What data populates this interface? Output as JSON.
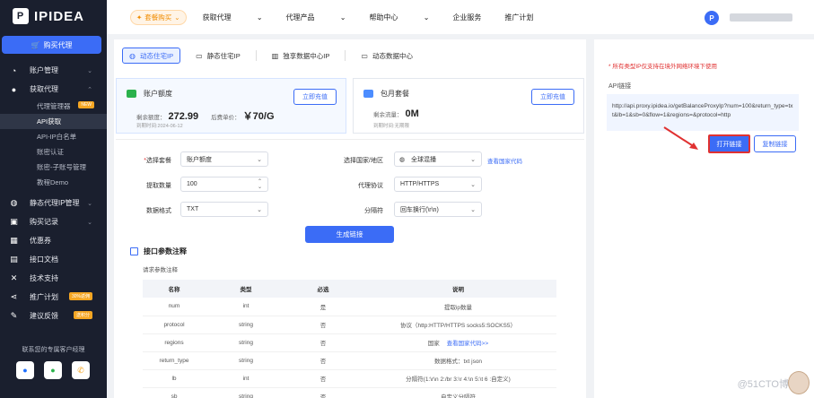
{
  "brand": {
    "name": "IPIDEA",
    "mark": "P"
  },
  "sidebar": {
    "buy_button": "购买代理",
    "groups": [
      {
        "label": "账户管理",
        "icon": "pie-chart-icon"
      },
      {
        "label": "获取代理",
        "icon": "user-icon"
      }
    ],
    "sub_items": [
      {
        "label": "代理管理器",
        "badge": "NEW"
      },
      {
        "label": "API获取"
      },
      {
        "label": "API-IP白名单"
      },
      {
        "label": "账密认证"
      },
      {
        "label": "账密-子账号管理"
      },
      {
        "label": "教程Demo"
      }
    ],
    "lower_groups": [
      {
        "label": "静态代理IP管理",
        "icon": "globe-icon"
      },
      {
        "label": "购买记录",
        "icon": "gift-icon"
      },
      {
        "label": "优惠券",
        "icon": "grid-icon"
      },
      {
        "label": "接口文档",
        "icon": "doc-icon"
      },
      {
        "label": "技术支持",
        "icon": "tools-icon"
      },
      {
        "label": "推广计划",
        "icon": "share-icon",
        "badge": "30%返佣"
      },
      {
        "label": "建议反馈",
        "icon": "feedback-icon",
        "badge": "送积分"
      }
    ],
    "contact": "联系您的专属客户经理"
  },
  "topbar": {
    "promo": "套餐购买",
    "nav": [
      "获取代理",
      "代理产品",
      "帮助中心",
      "企业服务",
      "推广计划"
    ]
  },
  "tabs": [
    "动态住宅IP",
    "静态住宅IP",
    "独享数据中心IP",
    "动态数据中心"
  ],
  "cards": {
    "balance": {
      "title": "账户额度",
      "remain_label": "剩余额度：",
      "remain_value": "272.99",
      "price_label": "后费单价：",
      "price_value": "￥70/G",
      "expire": "到期时间:2024-06-12",
      "button": "立即充值"
    },
    "monthly": {
      "title": "包月套餐",
      "remain_label": "剩余流量：",
      "remain_value": "0M",
      "expire": "到期时间:无期限",
      "button": "立即充值"
    }
  },
  "form": {
    "package_label": "选择套餐",
    "package_value": "账户额度",
    "country_label": "选择国家/地区",
    "country_value": "全球混播",
    "country_link": "查看国家代码",
    "count_label": "提取数量",
    "count_value": "100",
    "protocol_label": "代理协议",
    "protocol_value": "HTTP/HTTPS",
    "format_label": "数据格式",
    "format_value": "TXT",
    "sep_label": "分隔符",
    "sep_value": "回车换行(\\r\\n)",
    "generate": "生成链接"
  },
  "params": {
    "title": "接口参数注释",
    "subtitle": "请求参数注释",
    "headers": [
      "名称",
      "类型",
      "必选",
      "说明"
    ],
    "rows": [
      [
        "num",
        "int",
        "是",
        "提取ip数量"
      ],
      [
        "protocol",
        "string",
        "否",
        "协议（http:HTTP/HTTPS socks5:SOCKS5）"
      ],
      [
        "regions",
        "string",
        "否",
        "国家"
      ],
      [
        "return_type",
        "string",
        "否",
        "数据格式：txt json"
      ],
      [
        "lb",
        "int",
        "否",
        "分隔符(1:\\r\\n 2:/br 3:\\r 4:\\n 5:\\t 6 :自定义)"
      ],
      [
        "sb",
        "string",
        "否",
        "自定义分隔符"
      ]
    ],
    "regions_link": "查看国家代码>>"
  },
  "right": {
    "note": "* 所有类型IP仅支持在境外网络环境下使用",
    "api_label": "API链接",
    "api_url": "http://api.proxy.ipidea.io/getBalanceProxyIp?num=100&return_type=txt&lb=1&sb=0&flow=1&regions=&protocol=http",
    "open_button": "打开链接",
    "copy_button": "复制链接"
  },
  "watermark": "@51CTO博"
}
